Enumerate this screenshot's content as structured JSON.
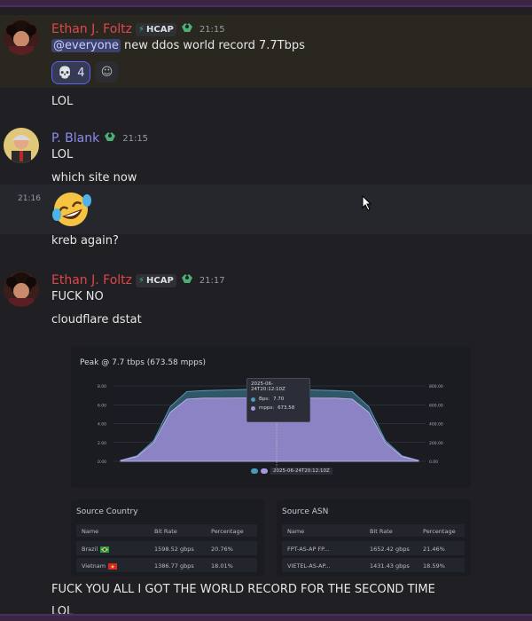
{
  "messages": [
    {
      "author": "Ethan J. Foltz",
      "tag": "HCAP",
      "time": "21:15",
      "mention": "@everyone",
      "text": " new ddos world record 7.7Tbps",
      "reaction_count": "4"
    },
    {
      "text": "LOL"
    },
    {
      "author": "P. Blank",
      "time": "21:15",
      "lines": [
        "LOL",
        "which site now"
      ]
    },
    {
      "time": "21:16",
      "emoji": "laughing",
      "text": "kreb again?"
    },
    {
      "author": "Ethan J. Foltz",
      "tag": "HCAP",
      "time": "21:17",
      "lines": [
        "FUCK NO",
        "cloudflare dstat"
      ]
    },
    {
      "lines": [
        "FUCK YOU ALL I GOT THE WORLD RECORD FOR THE SECOND TIME",
        "LOL"
      ]
    }
  ],
  "embed": {
    "title": "Peak @ 7.7 tbps (673.58 mpps)",
    "tooltip_time": "2025-06-24T20:12:10Z",
    "tooltip_rows": [
      {
        "label": "Bps:",
        "value": "7.70"
      },
      {
        "label": "mpps:",
        "value": "673.58"
      }
    ],
    "legend_time": "2025-06-24T20:12:10Z"
  },
  "chart_data": {
    "type": "area",
    "y_left_ticks": [
      "0.00",
      "2.00",
      "4.00",
      "6.00",
      "8.00"
    ],
    "y_right_ticks": [
      "0.00",
      "200.00",
      "400.00",
      "600.00",
      "800.00"
    ],
    "ylim": [
      0,
      8
    ],
    "series": [
      {
        "name": "Bps",
        "color": "#3a6a80",
        "values": [
          0.1,
          0.6,
          2.2,
          5.8,
          7.4,
          7.5,
          7.55,
          7.6,
          7.65,
          7.7,
          7.65,
          7.6,
          7.55,
          7.5,
          7.4,
          5.8,
          2.2,
          0.6,
          0.1
        ]
      },
      {
        "name": "mpps",
        "color": "#9c8bd6",
        "values": [
          0.1,
          0.5,
          2.0,
          5.2,
          6.6,
          6.7,
          6.7,
          6.72,
          6.73,
          6.74,
          6.73,
          6.72,
          6.7,
          6.7,
          6.6,
          5.2,
          2.0,
          0.5,
          0.1
        ]
      }
    ]
  },
  "tables": {
    "country": {
      "title": "Source Country",
      "headers": [
        "Name",
        "Bit Rate",
        "Percentage"
      ],
      "rows": [
        {
          "name": "Brazil",
          "flag": "brazil",
          "rate": "1598.52 gbps",
          "pct": "20.76%"
        },
        {
          "name": "Vietnam",
          "flag": "vietnam",
          "rate": "1386.77 gbps",
          "pct": "18.01%"
        }
      ]
    },
    "asn": {
      "title": "Source ASN",
      "headers": [
        "Name",
        "Bit Rate",
        "Percentage"
      ],
      "rows": [
        {
          "name": "FPT-AS-AP FP...",
          "rate": "1652.42 gbps",
          "pct": "21.46%"
        },
        {
          "name": "VIETEL-AS-AP...",
          "rate": "1431.43 gbps",
          "pct": "18.59%"
        }
      ]
    }
  }
}
